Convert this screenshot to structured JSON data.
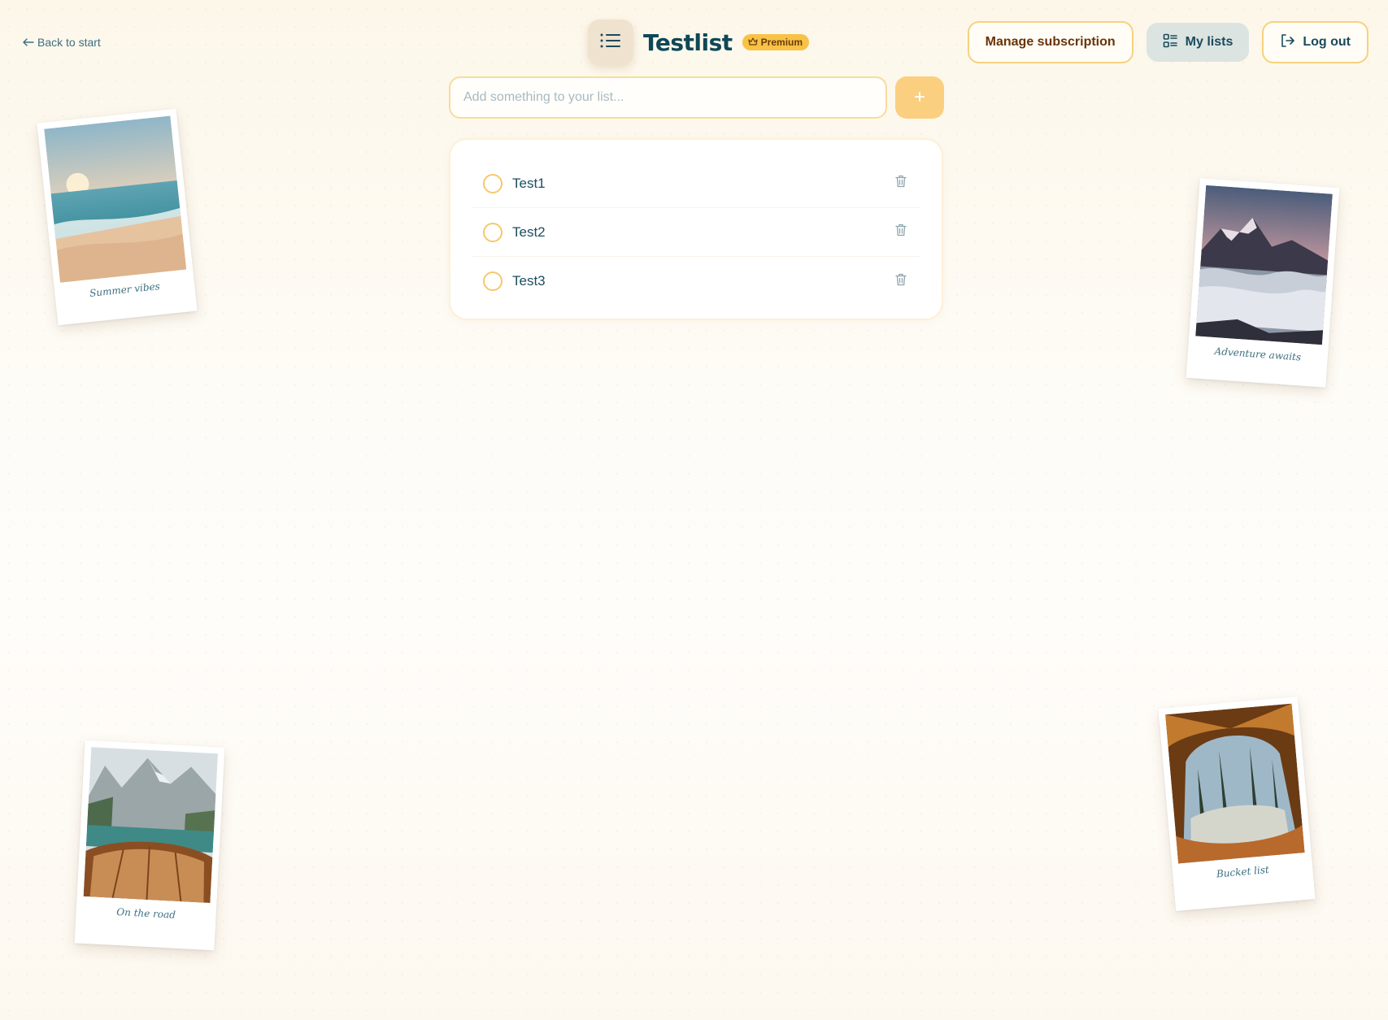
{
  "nav": {
    "back_label": "Back to start"
  },
  "brand": {
    "title": "Testlist",
    "badge": "Premium"
  },
  "header": {
    "manage_subscription": "Manage subscription",
    "my_lists": "My lists",
    "log_out": "Log out"
  },
  "add": {
    "placeholder": "Add something to your list...",
    "button": "+"
  },
  "items": [
    {
      "label": "Test1"
    },
    {
      "label": "Test2"
    },
    {
      "label": "Test3"
    }
  ],
  "polaroids": [
    {
      "caption": "Summer vibes",
      "scene": "beach-sunset"
    },
    {
      "caption": "Adventure awaits",
      "scene": "mountains-above-clouds"
    },
    {
      "caption": "On the road",
      "scene": "boat-lake-mountains"
    },
    {
      "caption": "Bucket list",
      "scene": "tent-view-forest"
    }
  ],
  "colors": {
    "accent": "#f8c247",
    "primary_text": "#0f4758",
    "add_button": "#fbcf80",
    "outline_border": "#f6d27d"
  }
}
